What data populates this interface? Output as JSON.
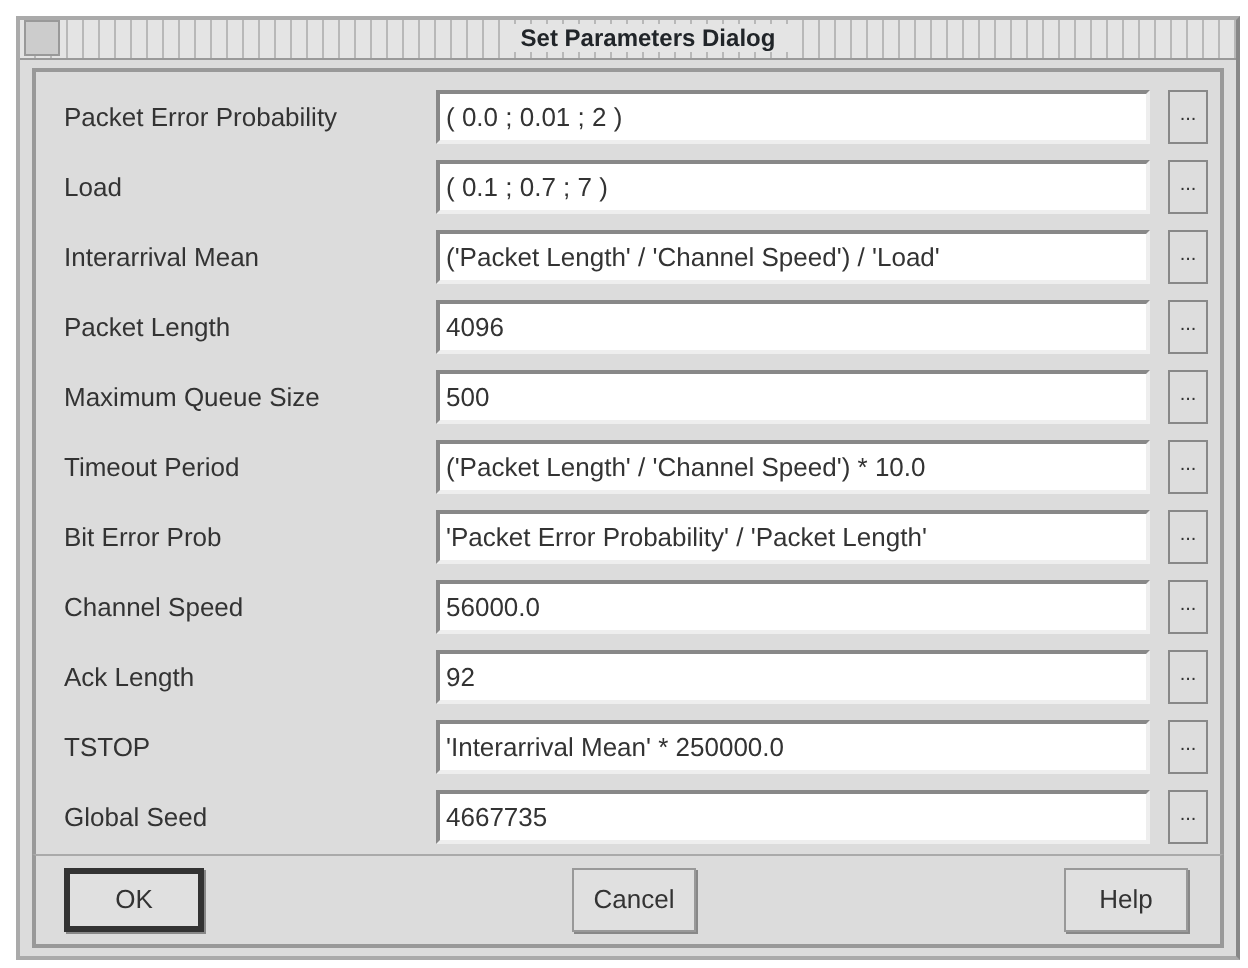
{
  "window": {
    "title": "Set Parameters Dialog"
  },
  "parameters": [
    {
      "label": "Packet Error Probability",
      "value": "( 0.0 ; 0.01 ; 2 )",
      "button": "..."
    },
    {
      "label": "Load",
      "value": "( 0.1 ; 0.7 ; 7 )",
      "button": "..."
    },
    {
      "label": "Interarrival Mean",
      "value": "('Packet Length' / 'Channel Speed') / 'Load'",
      "button": "..."
    },
    {
      "label": "Packet Length",
      "value": "4096",
      "button": "..."
    },
    {
      "label": "Maximum Queue Size",
      "value": "500",
      "button": "..."
    },
    {
      "label": "Timeout Period",
      "value": "('Packet Length' / 'Channel Speed') * 10.0",
      "button": "..."
    },
    {
      "label": "Bit Error Prob",
      "value": "'Packet Error Probability' / 'Packet Length'",
      "button": "..."
    },
    {
      "label": "Channel Speed",
      "value": "56000.0",
      "button": "..."
    },
    {
      "label": "Ack Length",
      "value": "92",
      "button": "..."
    },
    {
      "label": "TSTOP",
      "value": "'Interarrival Mean' * 250000.0",
      "button": "..."
    },
    {
      "label": "Global Seed",
      "value": "4667735",
      "button": "..."
    }
  ],
  "buttons": [
    {
      "label": "OK",
      "default": true
    },
    {
      "label": "Cancel",
      "default": false
    },
    {
      "label": "Help",
      "default": false
    }
  ]
}
